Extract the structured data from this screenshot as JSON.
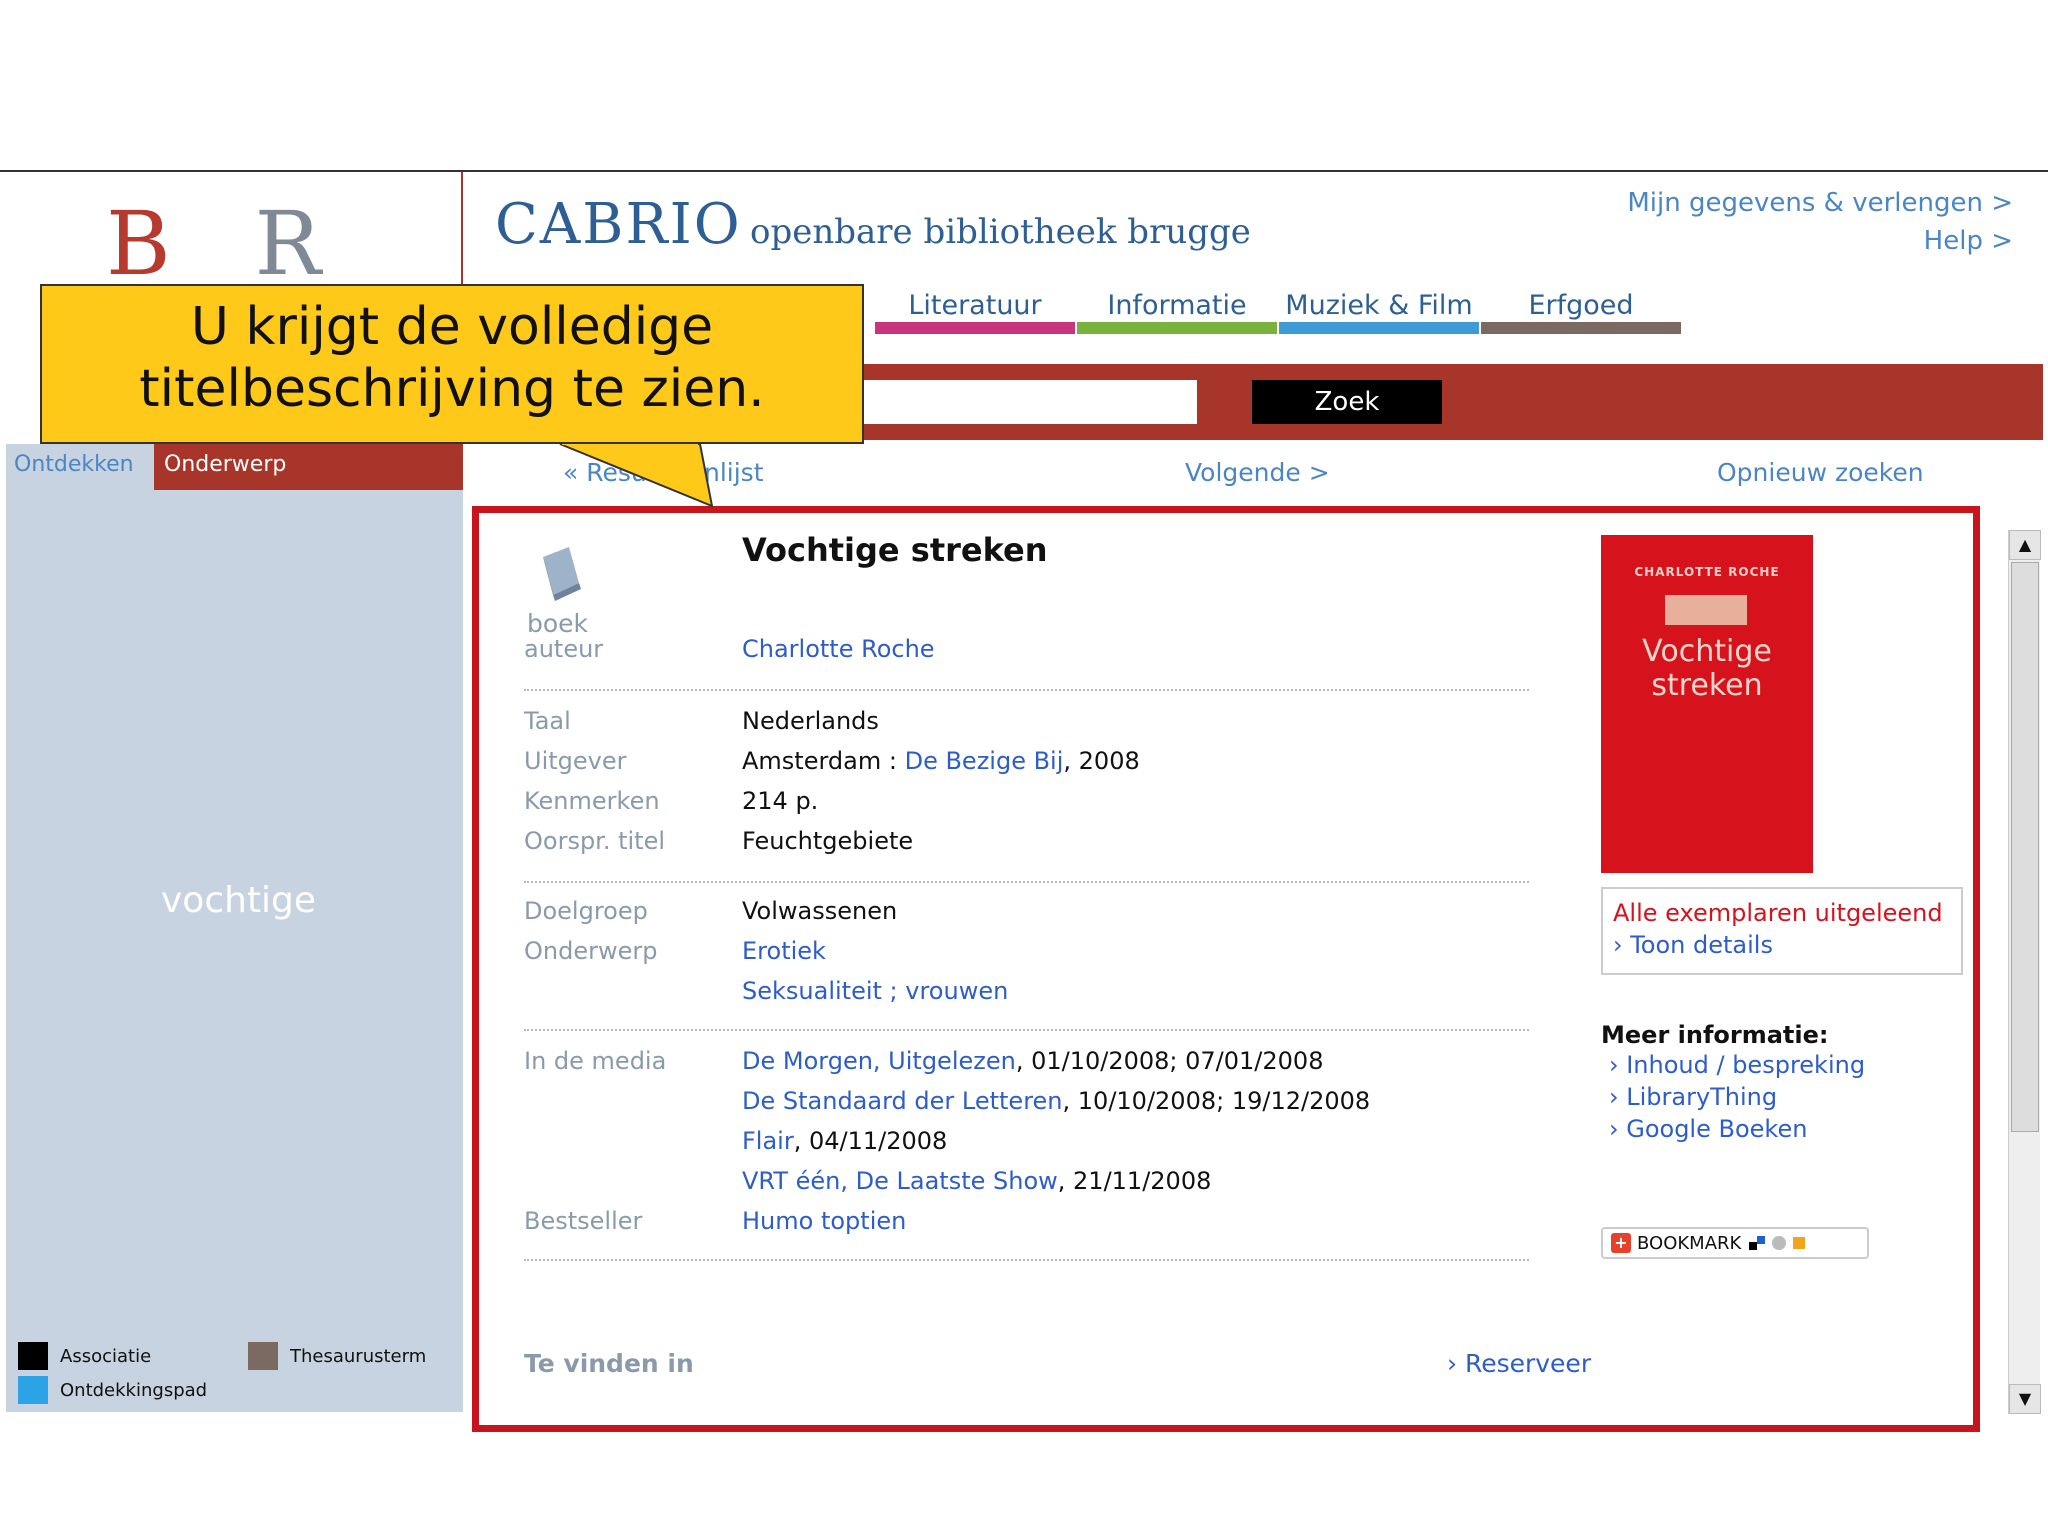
{
  "header": {
    "logo": "B R U",
    "brand": "CABRIO",
    "subtitle": "openbare bibliotheek brugge",
    "links": [
      "Mijn gegevens & verlengen >",
      "Help >"
    ]
  },
  "nav": [
    {
      "label": "Literatuur",
      "color": "#c9357d"
    },
    {
      "label": "Informatie",
      "color": "#79b33e"
    },
    {
      "label": "Muziek & Film",
      "color": "#3e9bd8"
    },
    {
      "label": "Erfgoed",
      "color": "#7a6a62"
    }
  ],
  "search": {
    "button": "Zoek"
  },
  "left": {
    "tabs": [
      "Ontdekken",
      "Onderwerp"
    ],
    "term": "vochtige",
    "legend": [
      {
        "label": "Associatie",
        "color": "#000000"
      },
      {
        "label": "Thesaurusterm",
        "color": "#7a6a62"
      },
      {
        "label": "Ontdekkingspad",
        "color": "#2ba3e6"
      }
    ]
  },
  "resultnav": {
    "back": "« Resultatenlijst",
    "next": "Volgende >",
    "again": "Opnieuw zoeken"
  },
  "record": {
    "type": "boek",
    "title": "Vochtige streken",
    "author_label": "auteur",
    "author": "Charlotte Roche",
    "fields": [
      {
        "label": "Taal",
        "value": "Nederlands"
      },
      {
        "label": "Uitgever",
        "value_pre": "Amsterdam : ",
        "value_link": "De Bezige Bij",
        "value_post": ", 2008"
      },
      {
        "label": "Kenmerken",
        "value": "214 p."
      },
      {
        "label": "Oorspr. titel",
        "value": "Feuchtgebiete"
      }
    ],
    "doelgroep_label": "Doelgroep",
    "doelgroep": "Volwassenen",
    "onderwerp_label": "Onderwerp",
    "onderwerpen": [
      "Erotiek",
      "Seksualiteit ; vrouwen"
    ],
    "media_label": "In de media",
    "media": [
      {
        "link": "De Morgen, Uitgelezen",
        "dates": ", 01/10/2008; 07/01/2008"
      },
      {
        "link": "De Standaard der Letteren",
        "dates": ", 10/10/2008; 19/12/2008"
      },
      {
        "link": "Flair",
        "dates": ", 04/11/2008"
      },
      {
        "link": "VRT één, De Laatste Show",
        "dates": ", 21/11/2008"
      }
    ],
    "bestseller_label": "Bestseller",
    "bestseller": "Humo toptien",
    "cover": {
      "author": "CHARLOTTE ROCHE",
      "title1": "Vochtige",
      "title2": "streken"
    },
    "availability": "Alle exemplaren uitgeleend",
    "details_link": "› Toon details",
    "meer_title": "Meer informatie:",
    "meer_links": [
      "› Inhoud / bespreking",
      "› LibraryThing",
      "› Google Boeken"
    ],
    "bookmark": "BOOKMARK",
    "vinden": "Te vinden in",
    "reserveer": "› Reserveer"
  },
  "callout": {
    "line1": "U krijgt de volledige",
    "line2": "titelbeschrijving te zien."
  }
}
